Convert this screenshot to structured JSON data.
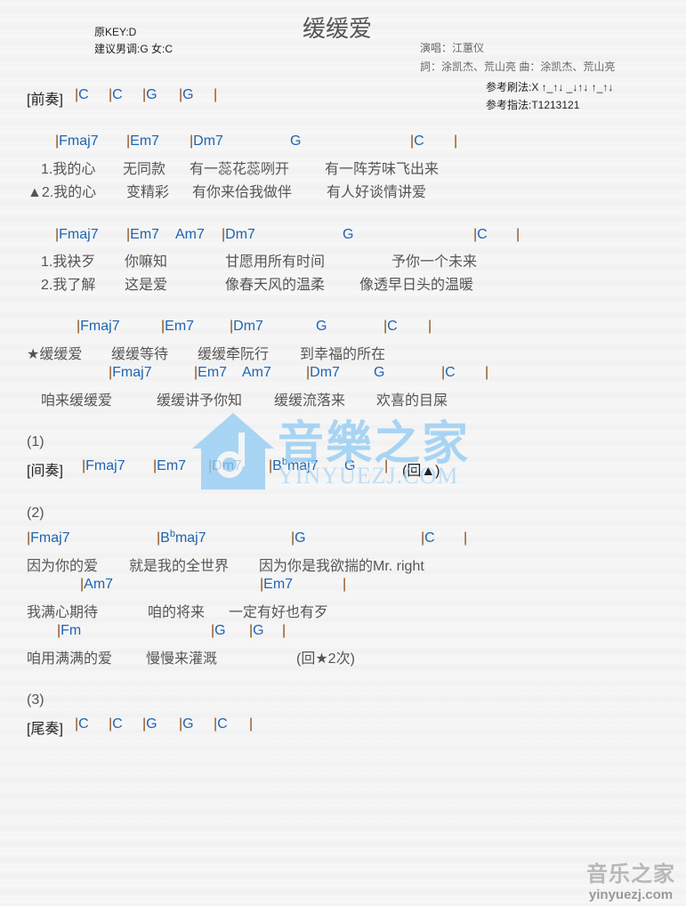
{
  "header": {
    "title": "缓缓爱",
    "original_key": "原KEY:D",
    "suggested_key": "建议男调:G 女:C",
    "singer": "演唱：江蕙仪",
    "credits": "詞：涂凯杰、荒山亮   曲：涂凯杰、荒山亮",
    "strum": "参考刷法:X ↑_↑↓ _↓↑↓ ↑_↑↓",
    "finger": "参考指法:T1213121"
  },
  "lines": [
    {
      "type": "chord",
      "label": "[前奏]",
      "items": [
        {
          "t": "C"
        },
        {
          "t": "C"
        },
        {
          "t": "G"
        },
        {
          "t": "G"
        },
        {
          "t": ""
        }
      ]
    },
    {
      "type": "chord",
      "items": [
        {
          "t": "Fmaj7"
        },
        {
          "t": "Em7"
        },
        {
          "t": "Dm7"
        },
        {
          "t": "G",
          "nobar": true
        },
        {
          "t": "C"
        },
        {
          "t": ""
        }
      ]
    },
    {
      "type": "lyric",
      "items": [
        "1.我的心",
        "无同款",
        "有一蕊花蕊咧开",
        "有一阵芳味飞出来"
      ]
    },
    {
      "type": "lyric",
      "items": [
        "▲2.我的心",
        "变精彩",
        "有你来佮我做伴",
        "有人好谈情讲爱"
      ]
    },
    {
      "type": "chord",
      "items": [
        {
          "t": "Fmaj7"
        },
        {
          "t": "Em7"
        },
        {
          "t": "Am7",
          "nobar": true
        },
        {
          "t": "Dm7"
        },
        {
          "t": "G",
          "nobar": true
        },
        {
          "t": "C"
        },
        {
          "t": ""
        }
      ]
    },
    {
      "type": "lyric",
      "items": [
        "1.我袂歹",
        "你嘛知",
        "甘愿用所有时间",
        "予你一个未来"
      ]
    },
    {
      "type": "lyric",
      "items": [
        "2.我了解",
        "这是爱",
        "像春天风的温柔",
        "像透早日头的温暖"
      ]
    },
    {
      "type": "chord",
      "items": [
        {
          "t": "Fmaj7"
        },
        {
          "t": "Em7"
        },
        {
          "t": "Dm7"
        },
        {
          "t": "G",
          "nobar": true
        },
        {
          "t": "C"
        },
        {
          "t": ""
        }
      ]
    },
    {
      "type": "lyric",
      "items": [
        "★缓缓爱",
        "缓缓等待",
        "缓缓牵阮行",
        "到幸福的所在"
      ]
    },
    {
      "type": "chord",
      "items": [
        {
          "t": "Fmaj7"
        },
        {
          "t": "Em7"
        },
        {
          "t": "Am7",
          "nobar": true
        },
        {
          "t": "Dm7"
        },
        {
          "t": "G",
          "nobar": true
        },
        {
          "t": "C"
        },
        {
          "t": ""
        }
      ]
    },
    {
      "type": "lyric",
      "items": [
        "咱来缓缓爱",
        "缓缓讲予你知",
        "缓缓流落来",
        "欢喜的目屎"
      ]
    },
    {
      "type": "lyric",
      "items": [
        "(1)"
      ]
    },
    {
      "type": "chord",
      "label": "[间奏]",
      "items": [
        {
          "t": "Fmaj7"
        },
        {
          "t": "Em7"
        },
        {
          "t": "Dm7"
        },
        {
          "t": "B",
          "sup": "b",
          "tail": "maj7"
        },
        {
          "t": "G",
          "nobar": true
        },
        {
          "t": ""
        }
      ],
      "note": "(回▲)"
    },
    {
      "type": "lyric",
      "items": [
        "(2)"
      ]
    },
    {
      "type": "chord",
      "items": [
        {
          "t": "Fmaj7"
        },
        {
          "t": "B",
          "sup": "b",
          "tail": "maj7"
        },
        {
          "t": "G"
        },
        {
          "t": "C"
        },
        {
          "t": ""
        }
      ]
    },
    {
      "type": "lyric",
      "items": [
        "因为你的爱",
        "就是我的全世界",
        "因为你是我欲揣的Mr. right"
      ]
    },
    {
      "type": "chord",
      "items": [
        {
          "t": "Am7"
        },
        {
          "t": "Em7"
        },
        {
          "t": ""
        }
      ]
    },
    {
      "type": "lyric",
      "items": [
        "我满心期待",
        "咱的将来",
        "一定有好也有歹"
      ]
    },
    {
      "type": "chord",
      "items": [
        {
          "t": "Fm"
        },
        {
          "t": "G"
        },
        {
          "t": "G"
        },
        {
          "t": ""
        }
      ]
    },
    {
      "type": "lyric",
      "items": [
        "咱用满满的爱",
        "慢慢来灌溉",
        "(回★2次)"
      ]
    },
    {
      "type": "lyric",
      "items": [
        "(3)"
      ]
    },
    {
      "type": "chord",
      "label": "[尾奏]",
      "items": [
        {
          "t": "C"
        },
        {
          "t": "C"
        },
        {
          "t": "G"
        },
        {
          "t": "G"
        },
        {
          "t": "C"
        },
        {
          "t": ""
        }
      ]
    }
  ],
  "watermark": {
    "text": "音樂之家",
    "url": "YINYUEZJ.COM",
    "color": "#8fcaf4"
  },
  "corner_watermark": {
    "text": "音乐之家",
    "url": "yinyuezj.com"
  },
  "colors": {
    "chord": "#1e64b4",
    "bar": "#8a4a10",
    "lyric": "#555555"
  }
}
